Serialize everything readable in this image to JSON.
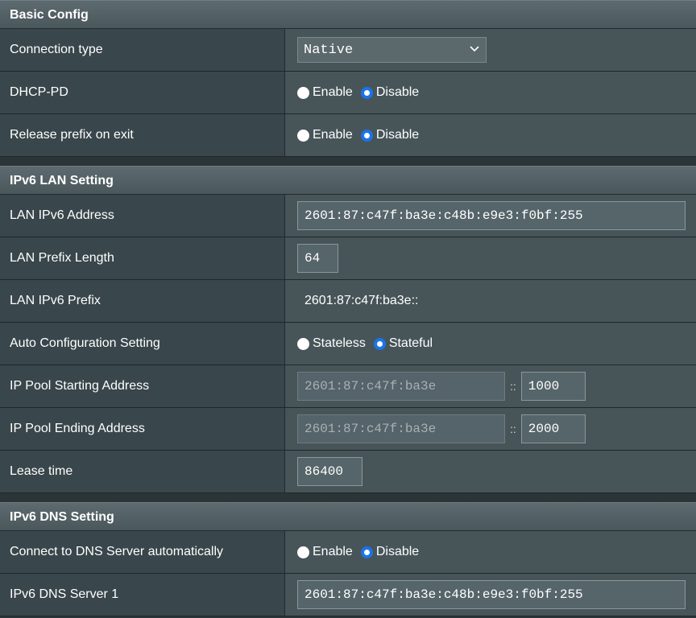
{
  "sections": {
    "basic": {
      "title": "Basic Config",
      "connection_type": {
        "label": "Connection type",
        "value": "Native"
      },
      "dhcp_pd": {
        "label": "DHCP-PD",
        "opt1": "Enable",
        "opt2": "Disable",
        "selected": "Disable"
      },
      "release_prefix": {
        "label": "Release prefix on exit",
        "opt1": "Enable",
        "opt2": "Disable",
        "selected": "Disable"
      }
    },
    "lan": {
      "title": "IPv6 LAN Setting",
      "lan_ipv6_address": {
        "label": "LAN IPv6 Address",
        "value": "2601:87:c47f:ba3e:c48b:e9e3:f0bf:255"
      },
      "lan_prefix_length": {
        "label": "LAN Prefix Length",
        "value": "64"
      },
      "lan_ipv6_prefix": {
        "label": "LAN IPv6 Prefix",
        "value": "2601:87:c47f:ba3e::"
      },
      "auto_config": {
        "label": "Auto Configuration Setting",
        "opt1": "Stateless",
        "opt2": "Stateful",
        "selected": "Stateful"
      },
      "pool_start": {
        "label": "IP Pool Starting Address",
        "prefix": "2601:87:c47f:ba3e",
        "sep": "::",
        "value": "1000"
      },
      "pool_end": {
        "label": "IP Pool Ending Address",
        "prefix": "2601:87:c47f:ba3e",
        "sep": "::",
        "value": "2000"
      },
      "lease_time": {
        "label": "Lease time",
        "value": "86400"
      }
    },
    "dns": {
      "title": "IPv6 DNS Setting",
      "auto_dns": {
        "label": "Connect to DNS Server automatically",
        "opt1": "Enable",
        "opt2": "Disable",
        "selected": "Disable"
      },
      "dns1": {
        "label": "IPv6 DNS Server 1",
        "value": "2601:87:c47f:ba3e:c48b:e9e3:f0bf:255"
      }
    }
  },
  "colors": {
    "radio_selected": "#1b74e8",
    "header_bg": "#4f5c60",
    "label_bg": "#39464b",
    "value_bg": "#475559"
  }
}
